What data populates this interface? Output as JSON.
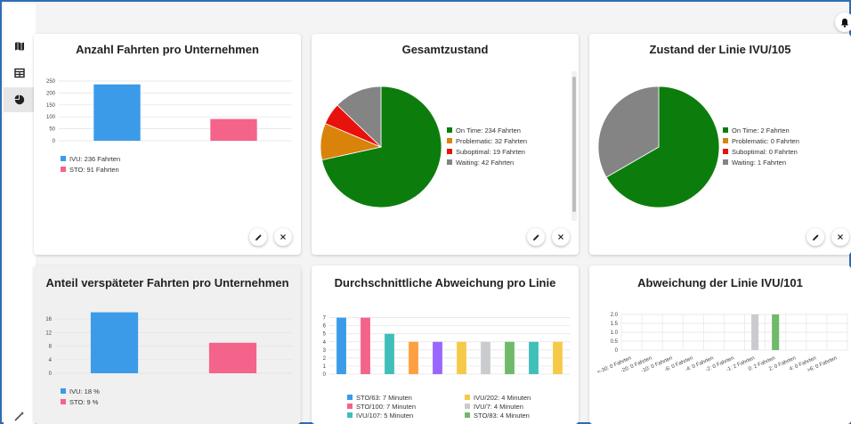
{
  "cards": {
    "trips": {
      "title": "Anzahl Fahrten pro Unternehmen",
      "legend": [
        "IVU: 236 Fahrten",
        "STO: 91 Fahrten"
      ]
    },
    "overall": {
      "title": "Gesamtzustand",
      "legend": [
        "On Time: 234 Fahrten",
        "Problematic: 32 Fahrten",
        "Suboptimal: 19 Fahrten",
        "Waiting: 42 Fahrten"
      ]
    },
    "line105": {
      "title": "Zustand der Linie IVU/105",
      "legend": [
        "On Time: 2 Fahrten",
        "Problematic: 0 Fahrten",
        "Suboptimal: 0 Fahrten",
        "Waiting: 1 Fahrten"
      ]
    },
    "late": {
      "title": "Anteil verspäteter Fahrten pro Unternehmen",
      "legend": [
        "IVU: 18 %",
        "STO: 9 %"
      ]
    },
    "avgdev": {
      "title": "Durchschnittliche Abweichung pro Linie",
      "legend": [
        "STO/63: 7 Minuten",
        "IVU/202: 4 Minuten",
        "STO/100: 7 Minuten",
        "IVU/7: 4 Minuten",
        "IVU/107: 5 Minuten",
        "STO/83: 4 Minuten"
      ]
    },
    "line101": {
      "title": "Abweichung der Linie IVU/101"
    }
  },
  "colors": {
    "blue": "#3b9be8",
    "pink": "#f4638a",
    "green": "#0c7d0c",
    "orange": "#d9830a",
    "red": "#e8120c",
    "grey": "#848484"
  },
  "chart_data": [
    {
      "type": "bar",
      "categories": [
        "IVU",
        "STO"
      ],
      "values": [
        236,
        91
      ],
      "title": "Anzahl Fahrten pro Unternehmen",
      "yticks": [
        "0",
        "50",
        "100",
        "150",
        "200",
        "250"
      ],
      "ylim": [
        0,
        250
      ]
    },
    {
      "type": "pie",
      "labels": [
        "On Time",
        "Problematic",
        "Suboptimal",
        "Waiting"
      ],
      "values": [
        234,
        32,
        19,
        42
      ],
      "title": "Gesamtzustand"
    },
    {
      "type": "pie",
      "labels": [
        "On Time",
        "Problematic",
        "Suboptimal",
        "Waiting"
      ],
      "values": [
        2,
        0,
        0,
        1
      ],
      "title": "Zustand der Linie IVU/105"
    },
    {
      "type": "bar",
      "categories": [
        "IVU",
        "STO"
      ],
      "values": [
        18,
        9
      ],
      "title": "Anteil verspäteter Fahrten pro Unternehmen",
      "yticks": [
        "0",
        "4",
        "8",
        "12",
        "16"
      ],
      "ylim": [
        0,
        20
      ]
    },
    {
      "type": "bar",
      "categories": [
        "STO/63",
        "STO/100",
        "IVU/107",
        "",
        "",
        "IVU/202",
        "IVU/7",
        "STO/83",
        "",
        ""
      ],
      "values": [
        7,
        7,
        5,
        4,
        4,
        4,
        4,
        4,
        4,
        4
      ],
      "title": "Durchschnittliche Abweichung pro Linie",
      "yticks": [
        "0",
        "1",
        "2",
        "3",
        "4",
        "5",
        "6",
        "7"
      ],
      "ylim": [
        0,
        7.4
      ]
    },
    {
      "type": "bar",
      "categories": [
        "<-30: 0 Fahrten",
        "-20: 0 Fahrten",
        "-10: 0 Fahrten",
        "-6: 0 Fahrten",
        "-4: 0 Fahrten",
        "-2: 0 Fahrten",
        "-1: 2 Fahrten",
        "0: 2 Fahrten",
        "2: 0 Fahrten",
        "4: 0 Fahrten",
        ">6: 0 Fahrten"
      ],
      "values": [
        0,
        0,
        0,
        0,
        0,
        0,
        2,
        2,
        0,
        0,
        0
      ],
      "title": "Abweichung der Linie IVU/101",
      "yticks": [
        "0",
        "0.5",
        "1.0",
        "1.5",
        "2.0"
      ],
      "ylim": [
        0,
        2
      ]
    }
  ]
}
